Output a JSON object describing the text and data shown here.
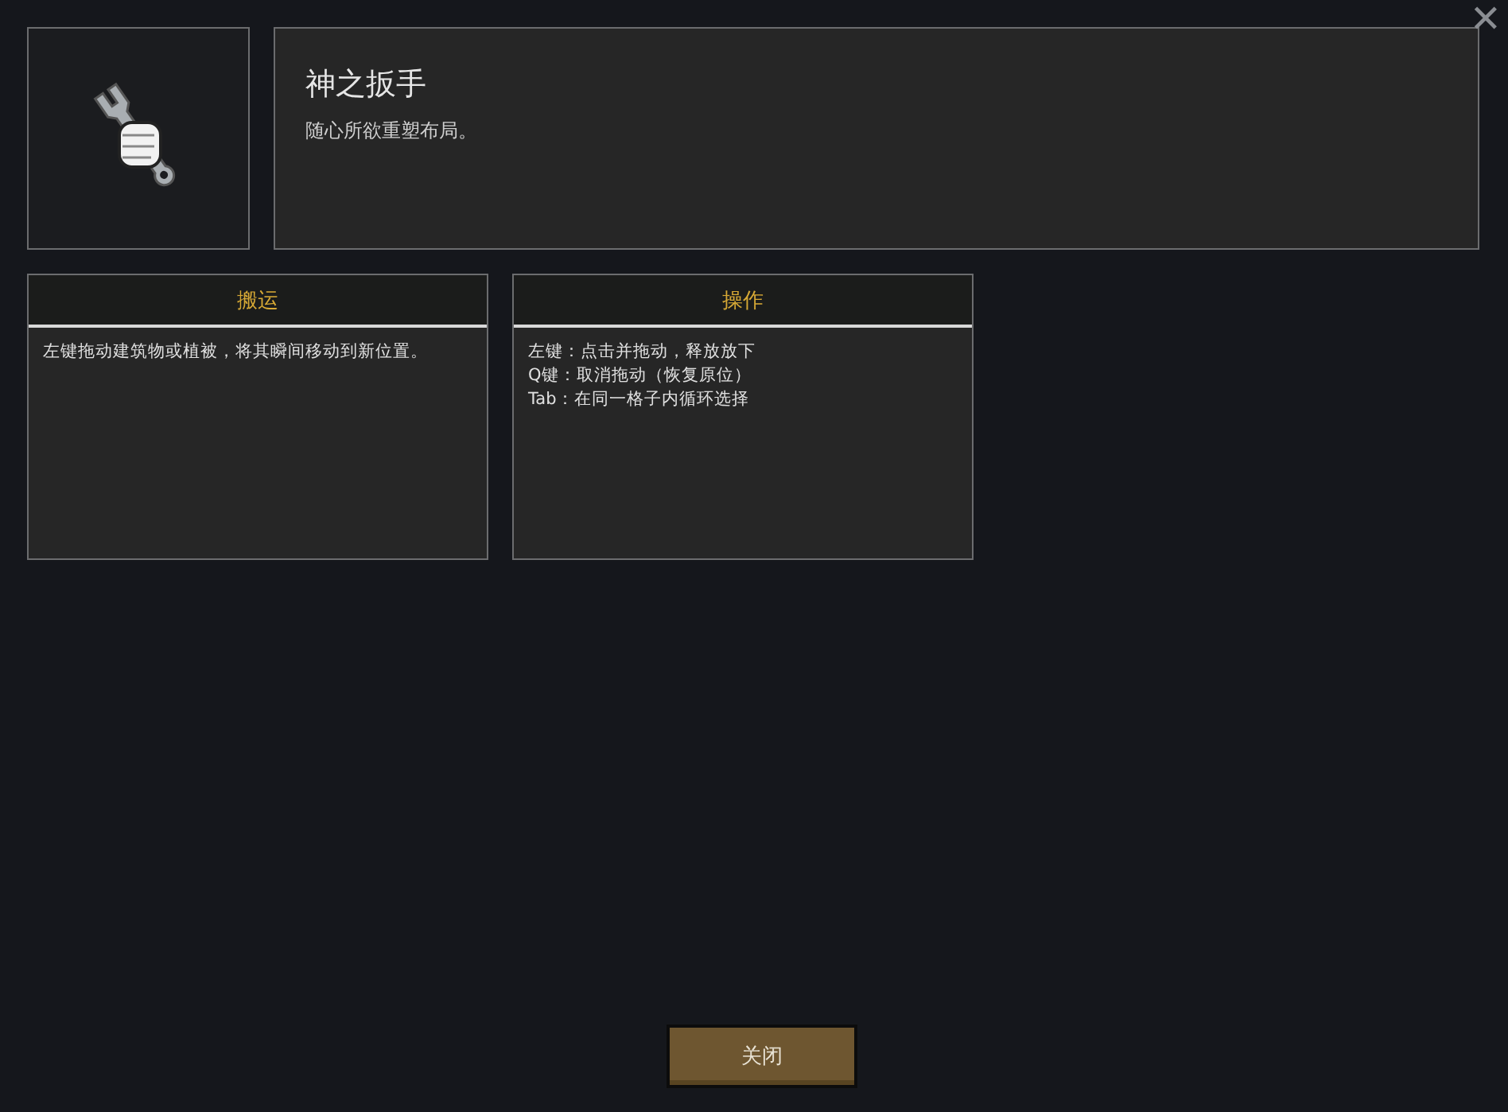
{
  "close_glyph": "✕",
  "header": {
    "title": "神之扳手",
    "description": "随心所欲重塑布局。"
  },
  "cards": [
    {
      "title": "搬运",
      "lines": [
        "左键拖动建筑物或植被，将其瞬间移动到新位置。"
      ]
    },
    {
      "title": "操作",
      "lines": [
        "左键：点击并拖动，释放放下",
        "Q键：取消拖动（恢复原位）",
        "Tab：在同一格子内循环选择"
      ]
    }
  ],
  "footer_button": "关闭"
}
